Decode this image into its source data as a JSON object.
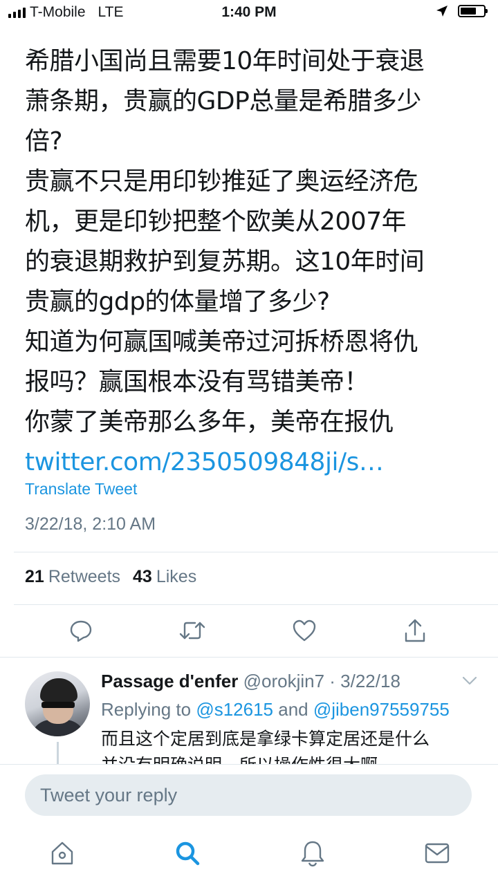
{
  "status_bar": {
    "carrier": "T-Mobile",
    "network": "LTE",
    "time": "1:40 PM",
    "battery_level": 0.7
  },
  "tweet": {
    "lines": [
      "希腊小国尚且需要10年时间处于衰退",
      "萧条期，贵赢的GDP总量是希腊多少",
      "倍?",
      "贵赢不只是用印钞推延了奥运经济危",
      "机，更是印钞把整个欧美从2007年",
      "的衰退期救护到复苏期。这10年时间",
      "贵赢的gdp的体量增了多少?",
      "知道为何赢国喊美帝过河拆桥恩将仇",
      "报吗？赢国根本没有骂错美帝！",
      "你蒙了美帝那么多年，美帝在报仇"
    ],
    "link": "twitter.com/2350509848ji/s…",
    "translate_label": "Translate Tweet",
    "timestamp": "3/22/18, 2:10 AM",
    "retweets_count": "21",
    "retweets_label": "Retweets",
    "likes_count": "43",
    "likes_label": "Likes"
  },
  "actions": {
    "reply_icon": "reply-icon",
    "retweet_icon": "retweet-icon",
    "like_icon": "heart-icon",
    "share_icon": "share-icon"
  },
  "reply": {
    "name": "Passage d'enfer",
    "handle_date": " @orokjin7 · 3/22/18",
    "replying_to_label": "Replying to ",
    "mention1": "@s12615",
    "and_label": " and ",
    "mention2": "@jiben97559755",
    "text_lines": [
      "而且这个定居到底是拿绿卡算定居还是什么",
      "并没有明确说明，所以操作性很大啊"
    ]
  },
  "compose": {
    "placeholder": "Tweet your reply"
  },
  "tabbar": {
    "items": [
      "home-icon",
      "search-icon",
      "notifications-icon",
      "messages-icon"
    ],
    "active": "search-icon"
  },
  "colors": {
    "accent": "#1b95e0",
    "secondary_text": "#657786",
    "primary_text": "#14171a",
    "divider": "#e1e8ed"
  }
}
